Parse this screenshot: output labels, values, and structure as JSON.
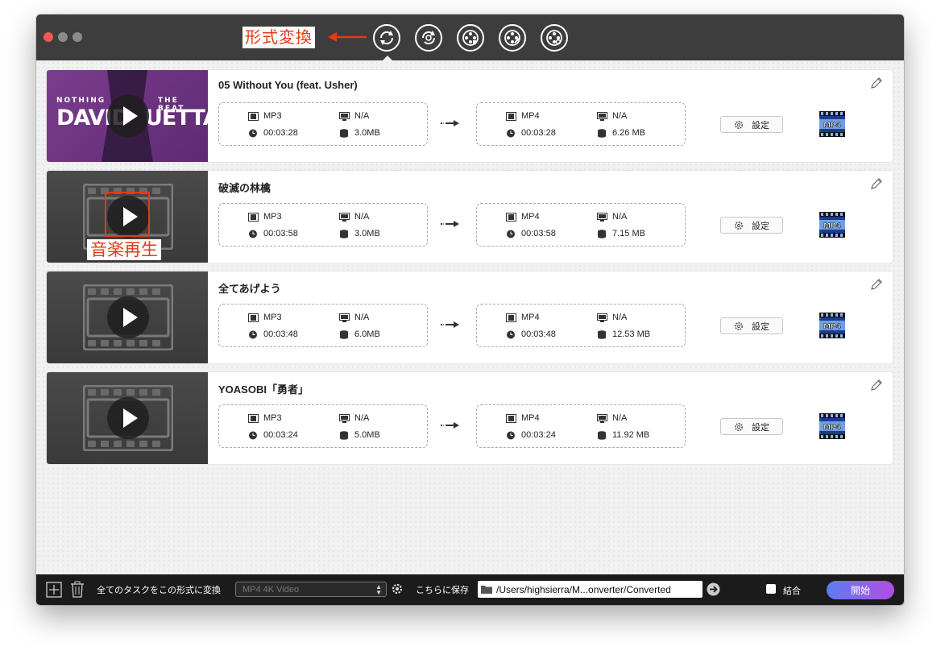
{
  "annotations": {
    "top_label": "形式変換",
    "play_caption": "音楽再生",
    "color": "#e53a14"
  },
  "toolbar": {
    "tools": [
      "convert-icon",
      "rip-icon",
      "film-download-icon",
      "film-edit-icon",
      "film-settings-icon"
    ]
  },
  "items": [
    {
      "title": "05 Without You (feat. Usher)",
      "thumbnail_text": {
        "line1a": "NOTHING",
        "line1b": "THE BEAT",
        "line2a": "DAVID",
        "line2b": "UETTA"
      },
      "source": {
        "format": "MP3",
        "resolution": "N/A",
        "duration": "00:03:28",
        "size": "3.0MB"
      },
      "target": {
        "format": "MP4",
        "resolution": "N/A",
        "duration": "00:03:28",
        "size": "6.26 MB"
      },
      "settings_label": "設定",
      "output_badge": "MP4"
    },
    {
      "title": "破滅の林檎",
      "source": {
        "format": "MP3",
        "resolution": "N/A",
        "duration": "00:03:58",
        "size": "3.0MB"
      },
      "target": {
        "format": "MP4",
        "resolution": "N/A",
        "duration": "00:03:58",
        "size": "7.15 MB"
      },
      "settings_label": "設定",
      "output_badge": "MP4"
    },
    {
      "title": "全てあげよう",
      "source": {
        "format": "MP3",
        "resolution": "N/A",
        "duration": "00:03:48",
        "size": "6.0MB"
      },
      "target": {
        "format": "MP4",
        "resolution": "N/A",
        "duration": "00:03:48",
        "size": "12.53 MB"
      },
      "settings_label": "設定",
      "output_badge": "MP4"
    },
    {
      "title": "YOASOBI「勇者」",
      "source": {
        "format": "MP3",
        "resolution": "N/A",
        "duration": "00:03:24",
        "size": "5.0MB"
      },
      "target": {
        "format": "MP4",
        "resolution": "N/A",
        "duration": "00:03:24",
        "size": "11.92 MB"
      },
      "settings_label": "設定",
      "output_badge": "MP4"
    }
  ],
  "bottom": {
    "convert_all_label": "全てのタスクをこの形式に変換",
    "format_select_value": "MP4 4K Video",
    "save_to_label": "こちらに保存",
    "output_path": "/Users/highsierra/M...onverter/Converted",
    "merge_label": "結合",
    "merge_checked": false,
    "start_label": "開始"
  }
}
